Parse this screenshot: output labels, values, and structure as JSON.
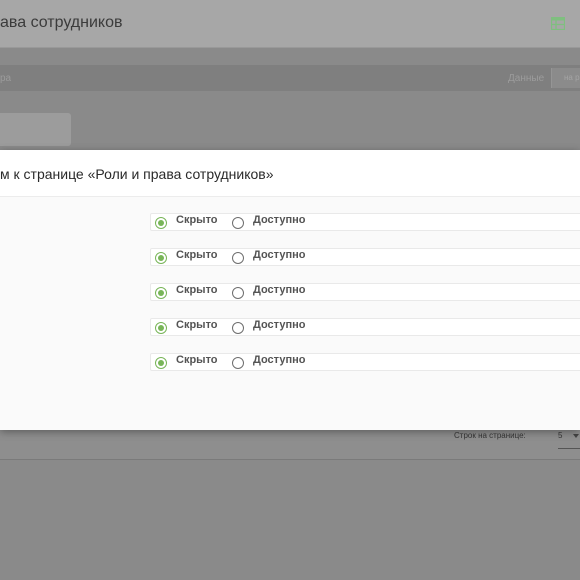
{
  "page": {
    "title": "ава сотрудников",
    "filter_left_text": "ра",
    "filter_right_label": "Данные",
    "filter_right_input_text": "на р",
    "icon_color": "#7fbf7f"
  },
  "pagination": {
    "rows_label": "Строк на странице:",
    "rows_value": "5"
  },
  "modal": {
    "title": "м к странице «Роли и права сотрудников»",
    "accent_color": "#78b558",
    "rows": [
      {
        "hidden_label": "Скрыто",
        "available_label": "Доступно",
        "selected": "hidden"
      },
      {
        "hidden_label": "Скрыто",
        "available_label": "Доступно",
        "selected": "hidden"
      },
      {
        "hidden_label": "Скрыто",
        "available_label": "Доступно",
        "selected": "hidden"
      },
      {
        "hidden_label": "Скрыто",
        "available_label": "Доступно",
        "selected": "hidden"
      },
      {
        "hidden_label": "Скрыто",
        "available_label": "Доступно",
        "selected": "hidden"
      }
    ]
  }
}
